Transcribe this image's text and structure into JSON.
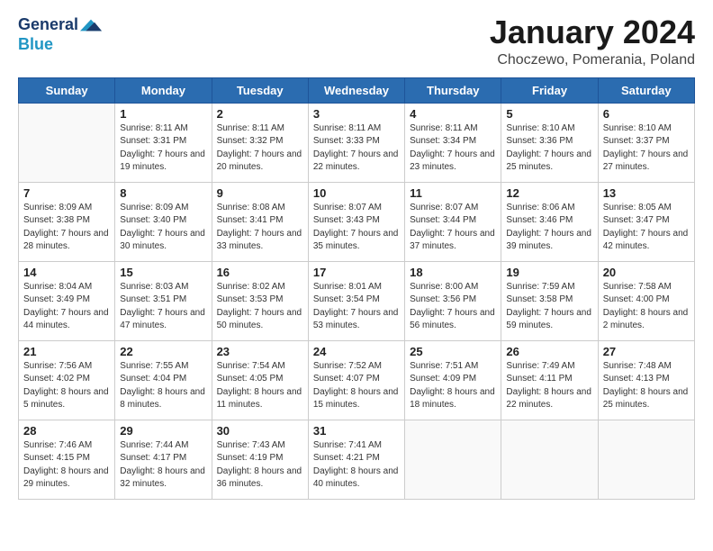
{
  "logo": {
    "line1": "General",
    "line2": "Blue"
  },
  "title": "January 2024",
  "subtitle": "Choczewo, Pomerania, Poland",
  "headers": [
    "Sunday",
    "Monday",
    "Tuesday",
    "Wednesday",
    "Thursday",
    "Friday",
    "Saturday"
  ],
  "weeks": [
    [
      {
        "day": "",
        "sunrise": "",
        "sunset": "",
        "daylight": ""
      },
      {
        "day": "1",
        "sunrise": "Sunrise: 8:11 AM",
        "sunset": "Sunset: 3:31 PM",
        "daylight": "Daylight: 7 hours and 19 minutes."
      },
      {
        "day": "2",
        "sunrise": "Sunrise: 8:11 AM",
        "sunset": "Sunset: 3:32 PM",
        "daylight": "Daylight: 7 hours and 20 minutes."
      },
      {
        "day": "3",
        "sunrise": "Sunrise: 8:11 AM",
        "sunset": "Sunset: 3:33 PM",
        "daylight": "Daylight: 7 hours and 22 minutes."
      },
      {
        "day": "4",
        "sunrise": "Sunrise: 8:11 AM",
        "sunset": "Sunset: 3:34 PM",
        "daylight": "Daylight: 7 hours and 23 minutes."
      },
      {
        "day": "5",
        "sunrise": "Sunrise: 8:10 AM",
        "sunset": "Sunset: 3:36 PM",
        "daylight": "Daylight: 7 hours and 25 minutes."
      },
      {
        "day": "6",
        "sunrise": "Sunrise: 8:10 AM",
        "sunset": "Sunset: 3:37 PM",
        "daylight": "Daylight: 7 hours and 27 minutes."
      }
    ],
    [
      {
        "day": "7",
        "sunrise": "Sunrise: 8:09 AM",
        "sunset": "Sunset: 3:38 PM",
        "daylight": "Daylight: 7 hours and 28 minutes."
      },
      {
        "day": "8",
        "sunrise": "Sunrise: 8:09 AM",
        "sunset": "Sunset: 3:40 PM",
        "daylight": "Daylight: 7 hours and 30 minutes."
      },
      {
        "day": "9",
        "sunrise": "Sunrise: 8:08 AM",
        "sunset": "Sunset: 3:41 PM",
        "daylight": "Daylight: 7 hours and 33 minutes."
      },
      {
        "day": "10",
        "sunrise": "Sunrise: 8:07 AM",
        "sunset": "Sunset: 3:43 PM",
        "daylight": "Daylight: 7 hours and 35 minutes."
      },
      {
        "day": "11",
        "sunrise": "Sunrise: 8:07 AM",
        "sunset": "Sunset: 3:44 PM",
        "daylight": "Daylight: 7 hours and 37 minutes."
      },
      {
        "day": "12",
        "sunrise": "Sunrise: 8:06 AM",
        "sunset": "Sunset: 3:46 PM",
        "daylight": "Daylight: 7 hours and 39 minutes."
      },
      {
        "day": "13",
        "sunrise": "Sunrise: 8:05 AM",
        "sunset": "Sunset: 3:47 PM",
        "daylight": "Daylight: 7 hours and 42 minutes."
      }
    ],
    [
      {
        "day": "14",
        "sunrise": "Sunrise: 8:04 AM",
        "sunset": "Sunset: 3:49 PM",
        "daylight": "Daylight: 7 hours and 44 minutes."
      },
      {
        "day": "15",
        "sunrise": "Sunrise: 8:03 AM",
        "sunset": "Sunset: 3:51 PM",
        "daylight": "Daylight: 7 hours and 47 minutes."
      },
      {
        "day": "16",
        "sunrise": "Sunrise: 8:02 AM",
        "sunset": "Sunset: 3:53 PM",
        "daylight": "Daylight: 7 hours and 50 minutes."
      },
      {
        "day": "17",
        "sunrise": "Sunrise: 8:01 AM",
        "sunset": "Sunset: 3:54 PM",
        "daylight": "Daylight: 7 hours and 53 minutes."
      },
      {
        "day": "18",
        "sunrise": "Sunrise: 8:00 AM",
        "sunset": "Sunset: 3:56 PM",
        "daylight": "Daylight: 7 hours and 56 minutes."
      },
      {
        "day": "19",
        "sunrise": "Sunrise: 7:59 AM",
        "sunset": "Sunset: 3:58 PM",
        "daylight": "Daylight: 7 hours and 59 minutes."
      },
      {
        "day": "20",
        "sunrise": "Sunrise: 7:58 AM",
        "sunset": "Sunset: 4:00 PM",
        "daylight": "Daylight: 8 hours and 2 minutes."
      }
    ],
    [
      {
        "day": "21",
        "sunrise": "Sunrise: 7:56 AM",
        "sunset": "Sunset: 4:02 PM",
        "daylight": "Daylight: 8 hours and 5 minutes."
      },
      {
        "day": "22",
        "sunrise": "Sunrise: 7:55 AM",
        "sunset": "Sunset: 4:04 PM",
        "daylight": "Daylight: 8 hours and 8 minutes."
      },
      {
        "day": "23",
        "sunrise": "Sunrise: 7:54 AM",
        "sunset": "Sunset: 4:05 PM",
        "daylight": "Daylight: 8 hours and 11 minutes."
      },
      {
        "day": "24",
        "sunrise": "Sunrise: 7:52 AM",
        "sunset": "Sunset: 4:07 PM",
        "daylight": "Daylight: 8 hours and 15 minutes."
      },
      {
        "day": "25",
        "sunrise": "Sunrise: 7:51 AM",
        "sunset": "Sunset: 4:09 PM",
        "daylight": "Daylight: 8 hours and 18 minutes."
      },
      {
        "day": "26",
        "sunrise": "Sunrise: 7:49 AM",
        "sunset": "Sunset: 4:11 PM",
        "daylight": "Daylight: 8 hours and 22 minutes."
      },
      {
        "day": "27",
        "sunrise": "Sunrise: 7:48 AM",
        "sunset": "Sunset: 4:13 PM",
        "daylight": "Daylight: 8 hours and 25 minutes."
      }
    ],
    [
      {
        "day": "28",
        "sunrise": "Sunrise: 7:46 AM",
        "sunset": "Sunset: 4:15 PM",
        "daylight": "Daylight: 8 hours and 29 minutes."
      },
      {
        "day": "29",
        "sunrise": "Sunrise: 7:44 AM",
        "sunset": "Sunset: 4:17 PM",
        "daylight": "Daylight: 8 hours and 32 minutes."
      },
      {
        "day": "30",
        "sunrise": "Sunrise: 7:43 AM",
        "sunset": "Sunset: 4:19 PM",
        "daylight": "Daylight: 8 hours and 36 minutes."
      },
      {
        "day": "31",
        "sunrise": "Sunrise: 7:41 AM",
        "sunset": "Sunset: 4:21 PM",
        "daylight": "Daylight: 8 hours and 40 minutes."
      },
      {
        "day": "",
        "sunrise": "",
        "sunset": "",
        "daylight": ""
      },
      {
        "day": "",
        "sunrise": "",
        "sunset": "",
        "daylight": ""
      },
      {
        "day": "",
        "sunrise": "",
        "sunset": "",
        "daylight": ""
      }
    ]
  ]
}
